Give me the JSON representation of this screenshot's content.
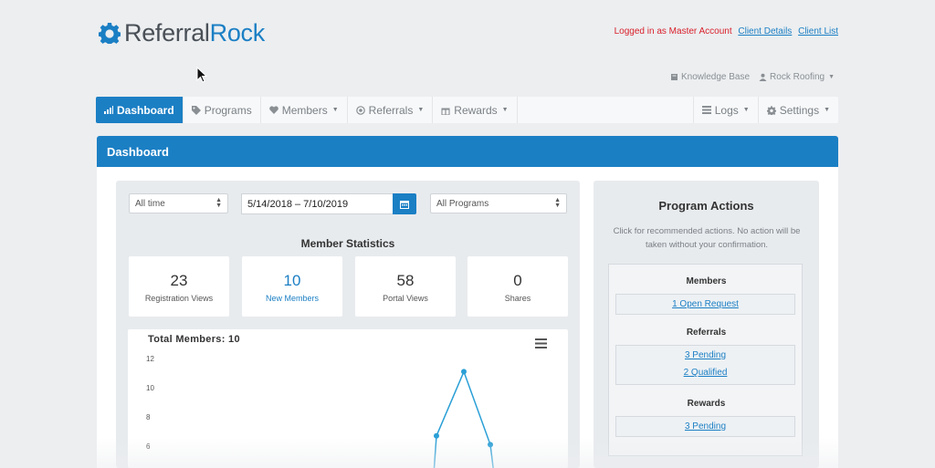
{
  "brand": {
    "word1": "Referral",
    "word2": "Rock",
    "color_gray": "#4a5057",
    "color_blue": "#1b7fc4"
  },
  "header": {
    "login_text": "Logged in as Master Account",
    "client_details": "Client Details",
    "client_list": "Client List"
  },
  "utility": {
    "knowledge_base": "Knowledge Base",
    "account": "Rock Roofing"
  },
  "nav": {
    "dashboard": "Dashboard",
    "programs": "Programs",
    "members": "Members",
    "referrals": "Referrals",
    "rewards": "Rewards",
    "logs": "Logs",
    "settings": "Settings"
  },
  "dashboard": {
    "title": "Dashboard",
    "filters": {
      "time": "All time",
      "date_range": "5/14/2018 – 7/10/2019",
      "program": "All Programs"
    },
    "stats_title": "Member Statistics",
    "stats": [
      {
        "value": "23",
        "label": "Registration Views"
      },
      {
        "value": "10",
        "label": "New Members"
      },
      {
        "value": "58",
        "label": "Portal Views"
      },
      {
        "value": "0",
        "label": "Shares"
      }
    ],
    "chart_title": "Total Members: 10"
  },
  "chart_data": {
    "type": "line",
    "title": "Total Members: 10",
    "y_ticks": [
      "12",
      "10",
      "8",
      "6"
    ],
    "ylim": [
      6,
      12
    ],
    "series": [
      {
        "color": "#2a9fd6",
        "x": [
          0,
          1,
          2
        ],
        "values": [
          6.7,
          11.1,
          6.1
        ]
      }
    ],
    "grid": false
  },
  "program_actions": {
    "title": "Program Actions",
    "description": "Click for recommended actions. No action will be taken without your confirmation.",
    "members_heading": "Members",
    "members_link": "1 Open Request",
    "referrals_heading": "Referrals",
    "referrals_pending": "3 Pending",
    "referrals_qualified": "2 Qualified",
    "rewards_heading": "Rewards",
    "rewards_pending": "3 Pending"
  }
}
